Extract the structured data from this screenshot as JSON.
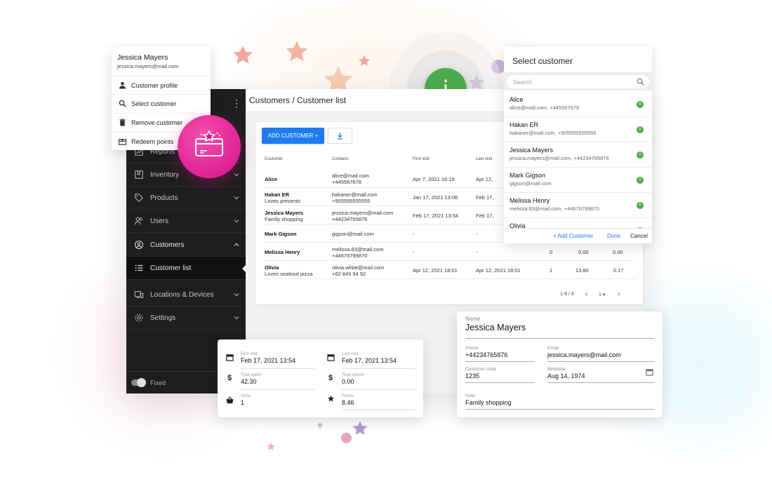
{
  "colors": {
    "accent": "#1e7cf0",
    "sidebar_bg": "#1e1e1e",
    "info_green": "#4cae4c",
    "badge_pink": "#e61d97",
    "star_pink": "#f0a7a0",
    "star_purple": "#b49ad6"
  },
  "context_menu": {
    "user_name": "Jessica Mayers",
    "user_email": "jessica.mayers@mail.com",
    "items": [
      {
        "icon": "person-icon",
        "label": "Customer profile"
      },
      {
        "icon": "search-icon",
        "label": "Select customer"
      },
      {
        "icon": "trash-icon",
        "label": "Remove customer"
      },
      {
        "icon": "gift-card-icon",
        "label": "Redeem points"
      }
    ]
  },
  "sidebar": {
    "items": [
      {
        "icon": "chart-icon",
        "label": "Reports"
      },
      {
        "icon": "book-icon",
        "label": "Inventory"
      },
      {
        "icon": "tag-icon",
        "label": "Products"
      },
      {
        "icon": "users-icon",
        "label": "Users"
      },
      {
        "icon": "person-circle-icon",
        "label": "Customers"
      },
      {
        "icon": "list-icon",
        "label": "Customer list"
      },
      {
        "icon": "devices-icon",
        "label": "Locations & Devices"
      },
      {
        "icon": "gear-icon",
        "label": "Settings"
      }
    ],
    "fixed_label": "Fixed"
  },
  "header": {
    "breadcrumb": "Customers / Customer list"
  },
  "toolbar": {
    "add_customer_label": "ADD CUSTOMER +"
  },
  "table": {
    "columns": [
      "Customer",
      "Contacts",
      "First visit",
      "Last visit"
    ],
    "rows": [
      {
        "name": "Alice",
        "note": "",
        "email": "alice@mail.com",
        "phone": "+445567678",
        "first": "Apr 7, 2021 16:19",
        "last": "Apr 12,",
        "visits": "",
        "spent": "",
        "refund": ""
      },
      {
        "name": "Hakan ER",
        "note": "Loves presents",
        "email": "hakaner@mail.com",
        "phone": "+905555555555",
        "first": "Jan 17, 2021 13:08",
        "last": "Feb 17,",
        "visits": "",
        "spent": "",
        "refund": ""
      },
      {
        "name": "Jessica Mayers",
        "note": "Family shopping",
        "email": "jessica.mayers@mail.com",
        "phone": "+44234765876",
        "first": "Feb 17, 2021 13:54",
        "last": "Feb 17,",
        "visits": "",
        "spent": "",
        "refund": ""
      },
      {
        "name": "Mark Gigson",
        "note": "",
        "email": "gigson@mail.com",
        "phone": "",
        "first": "-",
        "last": "-",
        "visits": "",
        "spent": "",
        "refund": ""
      },
      {
        "name": "Melissa Henry",
        "note": "",
        "email": "melissa.83@mail.com",
        "phone": "+44676799870",
        "first": "-",
        "last": "-",
        "visits": "0",
        "spent": "0.00",
        "refund": "0.00"
      },
      {
        "name": "Olivia",
        "note": "Loves seafood pizza",
        "email": "olivia.white@mail.com",
        "phone": "+62 849 94 92",
        "first": "Apr 12, 2021 18:01",
        "last": "Apr 12, 2021 18:01",
        "visits": "1",
        "spent": "13.80",
        "refund": "0.17"
      }
    ],
    "pagination": {
      "range": "1-6 / 6",
      "page": "1"
    }
  },
  "select_customer": {
    "title": "Select customer",
    "search_placeholder": "Search",
    "items": [
      {
        "name": "Alice",
        "sub": "alice@mail.com, +445567678"
      },
      {
        "name": "Hakan ER",
        "sub": "hakaner@mail.com, +905555555555"
      },
      {
        "name": "Jessica Mayers",
        "sub": "jessica.mayers@mail.com, +44234765876"
      },
      {
        "name": "Mark Gigson",
        "sub": "gigson@mail.com"
      },
      {
        "name": "Melissa Henry",
        "sub": "melissa.83@mail.com, +44676799870"
      },
      {
        "name": "Olivia",
        "sub": ""
      }
    ],
    "add_label": "+ Add Customer",
    "done_label": "Done",
    "cancel_label": "Cancel"
  },
  "stats": {
    "first_visit": {
      "label": "First visit",
      "value": "Feb 17, 2021 13:54"
    },
    "last_visit": {
      "label": "Last visit",
      "value": "Feb 17, 2021 13:54"
    },
    "total_spent": {
      "label": "Total spent",
      "value": "42.30"
    },
    "total_refund": {
      "label": "Total refund",
      "value": "0.00"
    },
    "visits": {
      "label": "Visits",
      "value": "1"
    },
    "points": {
      "label": "Points",
      "value": "8.46"
    }
  },
  "profile": {
    "name": {
      "label": "Name",
      "value": "Jessica Mayers"
    },
    "phone": {
      "label": "Phone",
      "value": "+44234765876"
    },
    "email": {
      "label": "Email",
      "value": "jessica.mayers@mail.com"
    },
    "code": {
      "label": "Customer code",
      "value": "1235"
    },
    "birthdate": {
      "label": "Birthdate",
      "value": "Aug 14, 1974"
    },
    "note": {
      "label": "Note",
      "value": "Family shopping"
    }
  }
}
